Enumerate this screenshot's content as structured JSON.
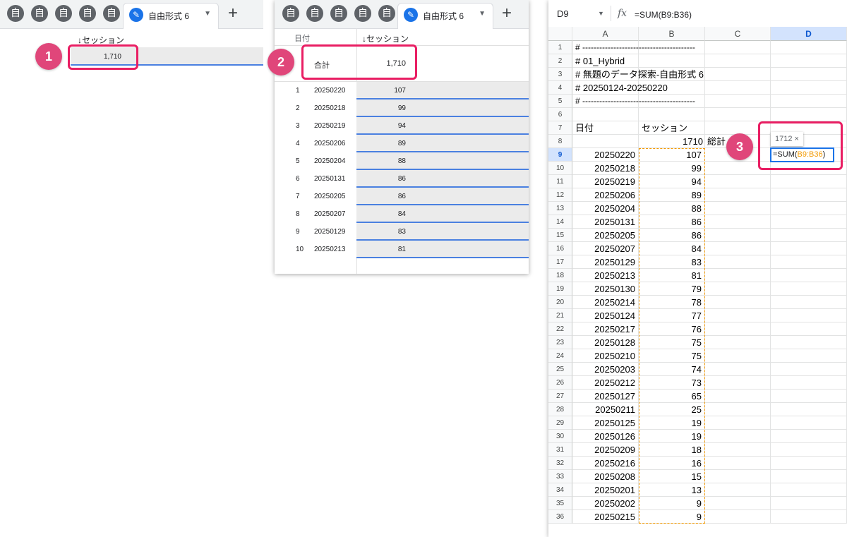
{
  "tabs": {
    "icon_glyph": "自",
    "pen_glyph": "✎",
    "active_label": "自由形式 6",
    "caret": "▼",
    "add": "+"
  },
  "callouts": [
    "1",
    "2",
    "3"
  ],
  "panel1": {
    "column_header": "↓セッション",
    "total_value": "1,710"
  },
  "panel2": {
    "date_header": "日付",
    "session_header": "↓セッション",
    "total_label": "合計",
    "total_value": "1,710",
    "rows": [
      {
        "n": "1",
        "date": "20250220",
        "value": "107"
      },
      {
        "n": "2",
        "date": "20250218",
        "value": "99"
      },
      {
        "n": "3",
        "date": "20250219",
        "value": "94"
      },
      {
        "n": "4",
        "date": "20250206",
        "value": "89"
      },
      {
        "n": "5",
        "date": "20250204",
        "value": "88"
      },
      {
        "n": "6",
        "date": "20250131",
        "value": "86"
      },
      {
        "n": "7",
        "date": "20250205",
        "value": "86"
      },
      {
        "n": "8",
        "date": "20250207",
        "value": "84"
      },
      {
        "n": "9",
        "date": "20250129",
        "value": "83"
      },
      {
        "n": "10",
        "date": "20250213",
        "value": "81"
      }
    ]
  },
  "sheet": {
    "name_box": "D9",
    "fx": "fx",
    "formula": "=SUM(B9:B36)",
    "columns": [
      "A",
      "B",
      "C",
      "D"
    ],
    "header_lines": [
      "# ----------------------------------------",
      "# 01_Hybrid",
      "# 無題のデータ探索-自由形式 6",
      "# 20250124-20250220",
      "# ----------------------------------------"
    ],
    "date_header": "日付",
    "session_header": "セッション",
    "total_value": "1710",
    "total_label": "総計",
    "tooltip": "1712 ×",
    "editing_formula": {
      "prefix": "=SUM(",
      "range": "B9:B36",
      "suffix": ")"
    },
    "data_rows": [
      {
        "date": "20250220",
        "value": "107"
      },
      {
        "date": "20250218",
        "value": "99"
      },
      {
        "date": "20250219",
        "value": "94"
      },
      {
        "date": "20250206",
        "value": "89"
      },
      {
        "date": "20250204",
        "value": "88"
      },
      {
        "date": "20250131",
        "value": "86"
      },
      {
        "date": "20250205",
        "value": "86"
      },
      {
        "date": "20250207",
        "value": "84"
      },
      {
        "date": "20250129",
        "value": "83"
      },
      {
        "date": "20250213",
        "value": "81"
      },
      {
        "date": "20250130",
        "value": "79"
      },
      {
        "date": "20250214",
        "value": "78"
      },
      {
        "date": "20250124",
        "value": "77"
      },
      {
        "date": "20250217",
        "value": "76"
      },
      {
        "date": "20250128",
        "value": "75"
      },
      {
        "date": "20250210",
        "value": "75"
      },
      {
        "date": "20250203",
        "value": "74"
      },
      {
        "date": "20250212",
        "value": "73"
      },
      {
        "date": "20250127",
        "value": "65"
      },
      {
        "date": "20250211",
        "value": "25"
      },
      {
        "date": "20250125",
        "value": "19"
      },
      {
        "date": "20250126",
        "value": "19"
      },
      {
        "date": "20250209",
        "value": "18"
      },
      {
        "date": "20250216",
        "value": "16"
      },
      {
        "date": "20250208",
        "value": "15"
      },
      {
        "date": "20250201",
        "value": "13"
      },
      {
        "date": "20250202",
        "value": "9"
      },
      {
        "date": "20250215",
        "value": "9"
      }
    ]
  },
  "colors": {
    "callout": "#e0467a",
    "highlight_border": "#e91e63",
    "selection_blue": "#1a73e8",
    "range_orange": "#f29900"
  }
}
